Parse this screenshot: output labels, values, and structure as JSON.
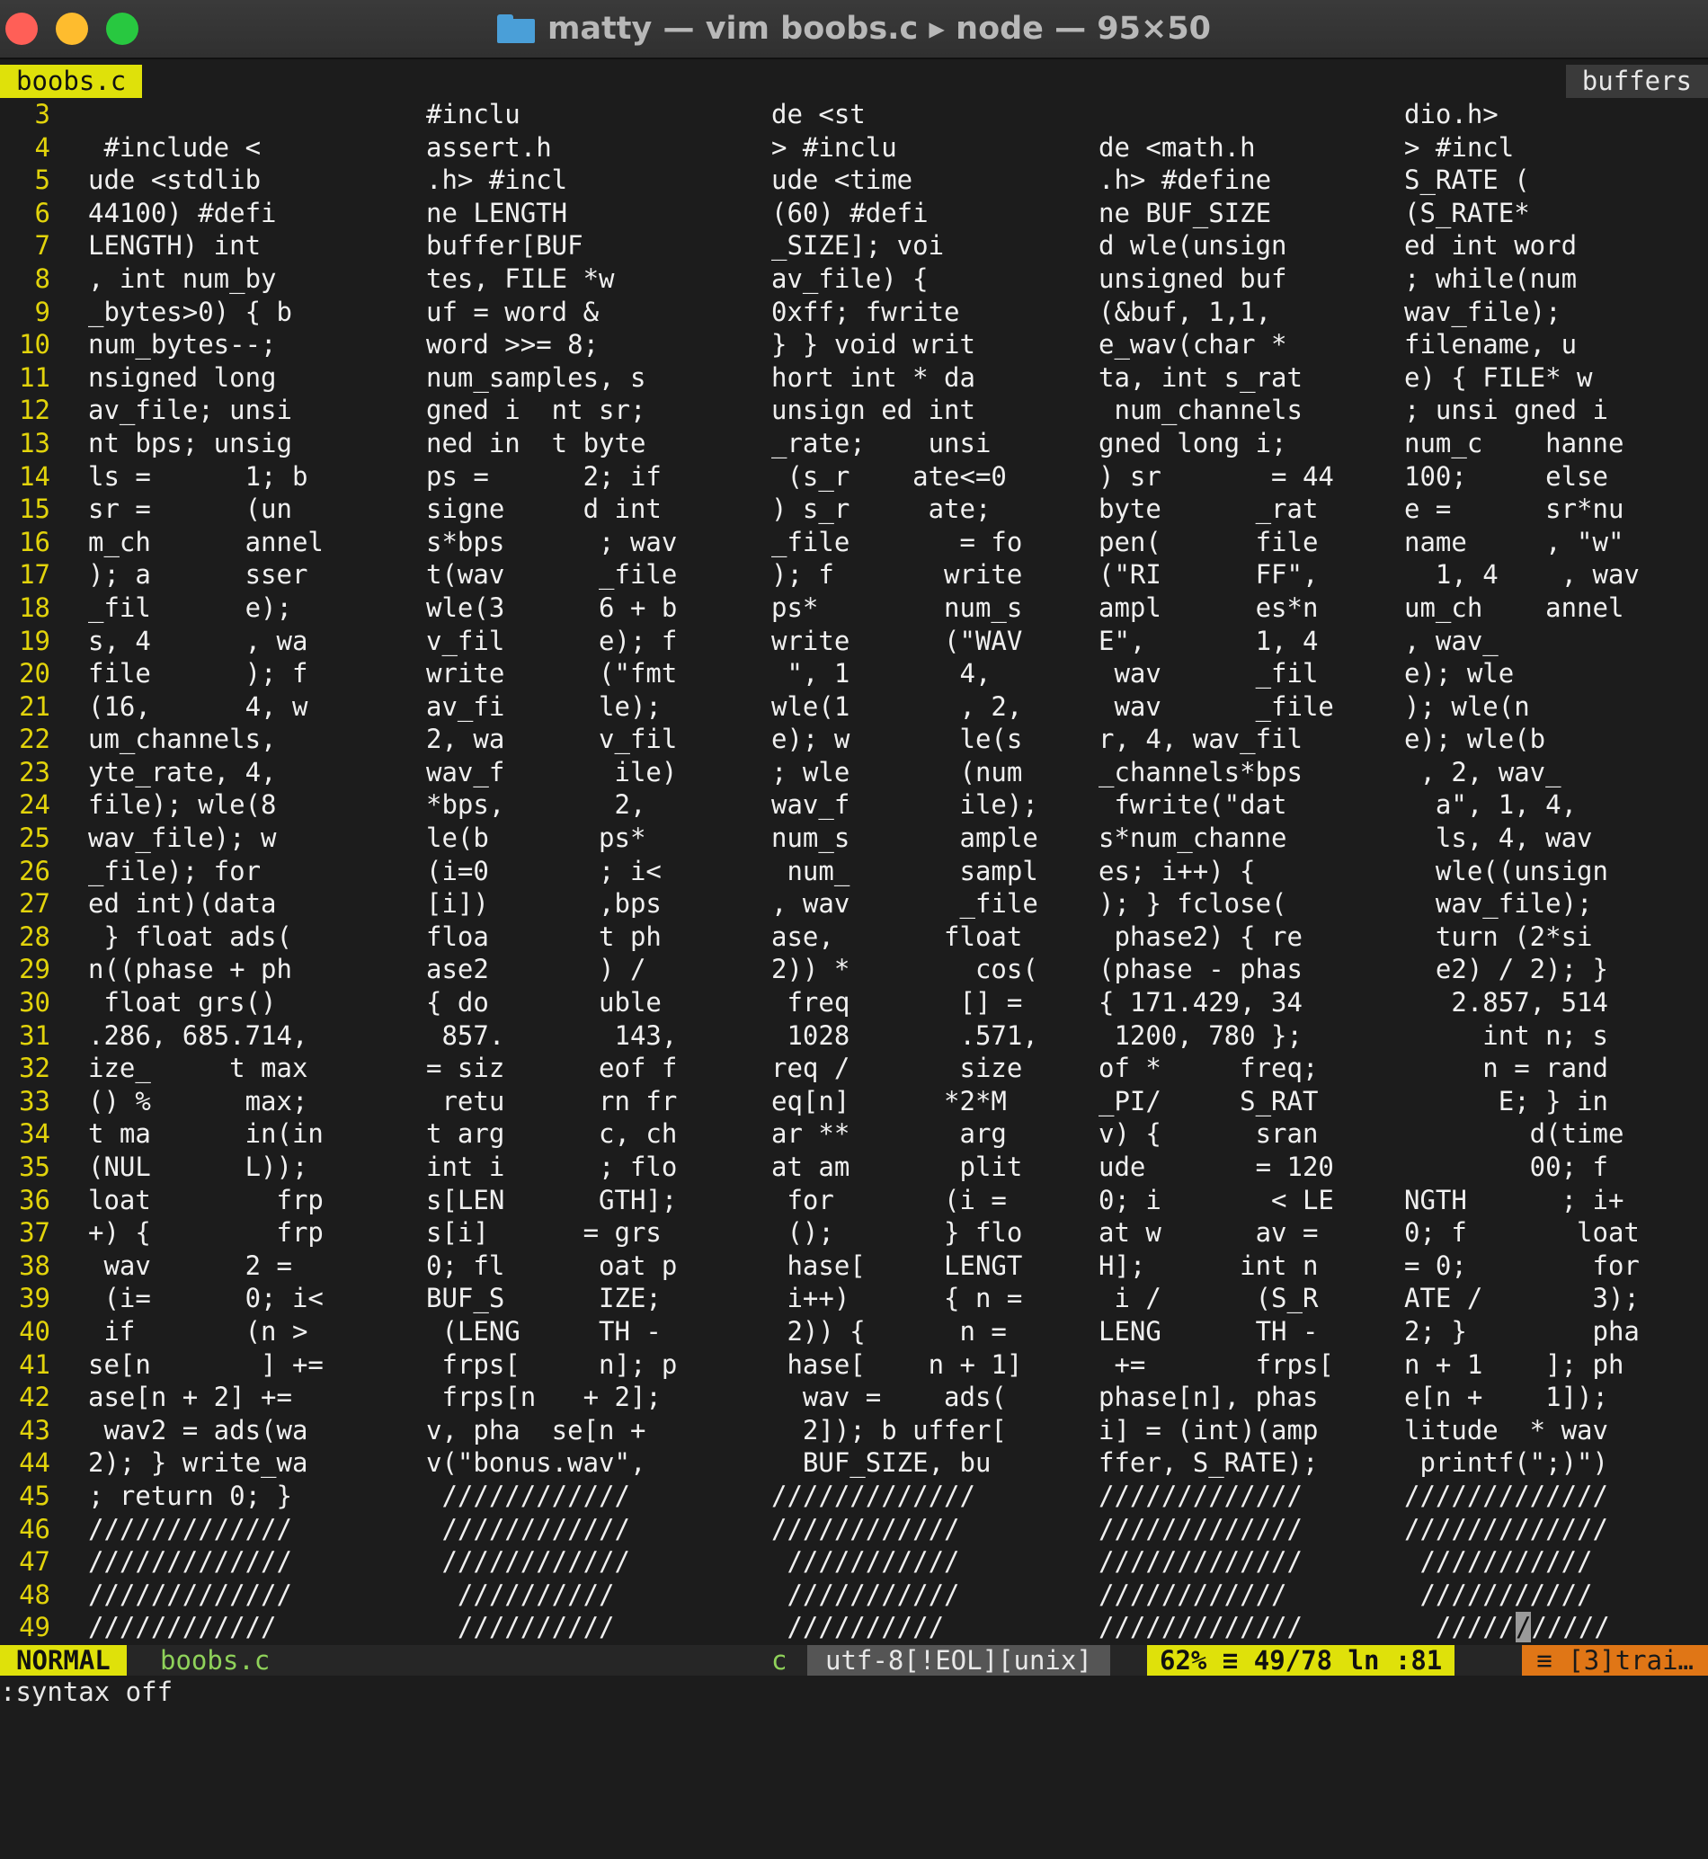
{
  "window": {
    "title": "matty — vim boobs.c ▸ node — 95×50"
  },
  "tabline": {
    "active_tab": "boobs.c",
    "right_label": "buffers"
  },
  "editor": {
    "lines": [
      {
        "n": "3",
        "f": [
          "",
          "#inclu",
          "de <st",
          "",
          "dio.h>"
        ]
      },
      {
        "n": "4",
        "f": [
          " #include <",
          "assert.h",
          "> #inclu",
          "de <math.h",
          "> #incl"
        ]
      },
      {
        "n": "5",
        "f": [
          "ude <stdlib",
          ".h> #incl",
          "ude <time",
          ".h> #define",
          "S_RATE ("
        ]
      },
      {
        "n": "6",
        "f": [
          "44100) #defi",
          "ne LENGTH",
          "(60) #defi",
          "ne BUF_SIZE",
          "(S_RATE*"
        ]
      },
      {
        "n": "7",
        "f": [
          "LENGTH) int",
          "buffer[BUF",
          "_SIZE]; voi",
          "d wle(unsign",
          "ed int word"
        ]
      },
      {
        "n": "8",
        "f": [
          ", int num_by",
          "tes, FILE *w",
          "av_file) {",
          "unsigned buf",
          "; while(num"
        ]
      },
      {
        "n": "9",
        "f": [
          "_bytes>0) { b",
          "uf = word &",
          "0xff; fwrite",
          "(&buf, 1,1,",
          "wav_file);"
        ]
      },
      {
        "n": "10",
        "f": [
          "num_bytes--;",
          "word >>= 8;",
          "} } void writ",
          "e_wav(char *",
          "filename, u"
        ]
      },
      {
        "n": "11",
        "f": [
          "nsigned long",
          "num_samples, s",
          "hort int * da",
          "ta, int s_rat",
          "e) { FILE* w"
        ]
      },
      {
        "n": "12",
        "f": [
          "av_file; unsi",
          "gned i  nt sr;",
          "unsign ed int",
          " num_channels",
          "; unsi gned i"
        ]
      },
      {
        "n": "13",
        "f": [
          "nt bps; unsig",
          "ned in  t byte",
          "_rate;    unsi",
          "gned long i;",
          "num_c    hanne"
        ]
      },
      {
        "n": "14",
        "f": [
          "ls =      1; b",
          "ps =      2; if",
          " (s_r    ate<=0",
          ") sr       = 44",
          "100;     else"
        ]
      },
      {
        "n": "15",
        "f": [
          "sr =      (un",
          "signe     d int",
          ") s_r     ate;",
          "byte      _rat",
          "e =      sr*nu"
        ]
      },
      {
        "n": "16",
        "f": [
          "m_ch      annel",
          "s*bps      ; wav",
          "_file       = fo",
          "pen(      file",
          "name     , \"w\""
        ]
      },
      {
        "n": "17",
        "f": [
          "); a      sser",
          "t(wav      _file",
          "); f       write",
          "(\"RI      FF\",",
          "  1, 4    , wav"
        ]
      },
      {
        "n": "18",
        "f": [
          "_fil      e);",
          "wle(3      6 + b",
          "ps*        num_s",
          "ampl      es*n",
          "um_ch    annel"
        ]
      },
      {
        "n": "19",
        "f": [
          "s, 4      , wa",
          "v_fil      e); f",
          "write      (\"WAV",
          "E\",       1, 4",
          ", wav_"
        ]
      },
      {
        "n": "20",
        "f": [
          "file      ); f",
          "write      (\"fmt",
          " \", 1       4,",
          " wav      _fil",
          "e); wle"
        ]
      },
      {
        "n": "21",
        "f": [
          "(16,      4, w",
          "av_fi      le);",
          "wle(1       , 2,",
          " wav      _file",
          "); wle(n"
        ]
      },
      {
        "n": "22",
        "f": [
          "um_channels,",
          "2, wa      v_fil",
          "e); w       le(s",
          "r, 4, wav_fil",
          "e); wle(b"
        ]
      },
      {
        "n": "23",
        "f": [
          "yte_rate, 4,",
          "wav_f       ile)",
          "; wle       (num",
          "_channels*bps",
          " , 2, wav_"
        ]
      },
      {
        "n": "24",
        "f": [
          "file); wle(8",
          "*bps,       2,",
          "wav_f       ile);",
          " fwrite(\"dat",
          "  a\", 1, 4,"
        ]
      },
      {
        "n": "25",
        "f": [
          "wav_file); w",
          "le(b       ps*",
          "num_s       ample",
          "s*num_channe",
          "  ls, 4, wav"
        ]
      },
      {
        "n": "26",
        "f": [
          "_file); for",
          "(i=0       ; i<",
          " num_       sampl",
          "es; i++) {",
          "  wle((unsign"
        ]
      },
      {
        "n": "27",
        "f": [
          "ed int)(data",
          "[i])       ,bps",
          ", wav       _file",
          "); } fclose(",
          "  wav_file);"
        ]
      },
      {
        "n": "28",
        "f": [
          " } float ads(",
          "floa       t ph",
          "ase,       float",
          " phase2) { re",
          "  turn (2*si"
        ]
      },
      {
        "n": "29",
        "f": [
          "n((phase + ph",
          "ase2       ) /",
          "2)) *        cos(",
          "(phase - phas",
          "  e2) / 2); }"
        ]
      },
      {
        "n": "30",
        "f": [
          " float grs()",
          "{ do       uble",
          " freq       [] =",
          "{ 171.429, 34",
          "   2.857, 514"
        ]
      },
      {
        "n": "31",
        "f": [
          ".286, 685.714,",
          " 857.       143,",
          " 1028       .571,",
          " 1200, 780 };",
          "     int n; s"
        ]
      },
      {
        "n": "32",
        "f": [
          "ize_     t max",
          "= siz      eof f",
          "req /       size",
          "of *     freq;",
          "     n = rand"
        ]
      },
      {
        "n": "33",
        "f": [
          "() %      max;",
          " retu      rn fr",
          "eq[n]      *2*M",
          "_PI/     S_RAT",
          "      E; } in"
        ]
      },
      {
        "n": "34",
        "f": [
          "t ma      in(in",
          "t arg      c, ch",
          "ar **       arg",
          "v) {      sran",
          "        d(time"
        ]
      },
      {
        "n": "35",
        "f": [
          "(NUL      L));",
          "int i      ; flo",
          "at am       plit",
          "ude       = 120",
          "        00; f"
        ]
      },
      {
        "n": "36",
        "f": [
          "loat        frp",
          "s[LEN      GTH];",
          " for       (i =",
          "0; i       < LE",
          "NGTH      ; i+"
        ]
      },
      {
        "n": "37",
        "f": [
          "+) {        frp",
          "s[i]      = grs",
          " ();       } flo",
          "at w      av =",
          "0; f       loat"
        ]
      },
      {
        "n": "38",
        "f": [
          " wav      2 =",
          "0; fl      oat p",
          " hase[     LENGT",
          "H];      int n",
          "= 0;        for"
        ]
      },
      {
        "n": "39",
        "f": [
          " (i=      0; i<",
          "BUF_S      IZE;",
          " i++)      { n =",
          " i /      (S_R",
          "ATE /       3);"
        ]
      },
      {
        "n": "40",
        "f": [
          " if       (n >",
          " (LENG     TH -",
          " 2)) {      n =",
          "LENG      TH -",
          "2; }        pha"
        ]
      },
      {
        "n": "41",
        "f": [
          "se[n       ] +=",
          " frps[     n]; p",
          " hase[    n + 1]",
          " +=       frps[",
          "n + 1    ]; ph"
        ]
      },
      {
        "n": "42",
        "f": [
          "ase[n + 2] +=",
          " frps[n   + 2];",
          "  wav =    ads(",
          "phase[n], phas",
          "e[n +    1]);"
        ]
      },
      {
        "n": "43",
        "f": [
          " wav2 = ads(wa",
          "v, pha  se[n +",
          "  2]); b uffer[",
          "i] = (int)(amp",
          "litude  * wav"
        ]
      },
      {
        "n": "44",
        "f": [
          "2); } write_wa",
          "v(\"bonus.wav\",",
          "  BUF_SIZE, bu",
          "ffer, S_RATE);",
          " printf(\";)\")"
        ]
      },
      {
        "n": "45",
        "f": [
          "; return 0; }",
          " ////////////",
          "/////////////",
          "/////////////",
          "/////////////"
        ]
      },
      {
        "n": "46",
        "f": [
          "/////////////",
          " ////////////",
          "////////////",
          "/////////////",
          "/////////////"
        ]
      },
      {
        "n": "47",
        "f": [
          "/////////////",
          " ////////////",
          " ///////////",
          "/////////////",
          " ///////////"
        ]
      },
      {
        "n": "48",
        "f": [
          "/////////////",
          "  //////////",
          " ///////////",
          "////////////",
          " ///////////"
        ]
      },
      {
        "n": "49",
        "f": [
          "////////////",
          "  //////////",
          " //////////",
          "/////////////",
          "  /////"
        ]
      }
    ],
    "cursor_char": "/",
    "cursor_after": "/////"
  },
  "statusline": {
    "mode": "NORMAL",
    "filename": "boobs.c",
    "filetype": "c",
    "encoding": "utf-8[!EOL][unix]",
    "position": "62% ≡ 49/78 ln :81",
    "warning": "≡ [3]trai…"
  },
  "cmdline": {
    "text": ":syntax off"
  },
  "colors": {
    "accent_yellow": "#dfe10a",
    "line_number": "#e2d30b",
    "filename_green": "#8fd25a",
    "warning_orange": "#e07616",
    "background": "#1c1c1c"
  }
}
